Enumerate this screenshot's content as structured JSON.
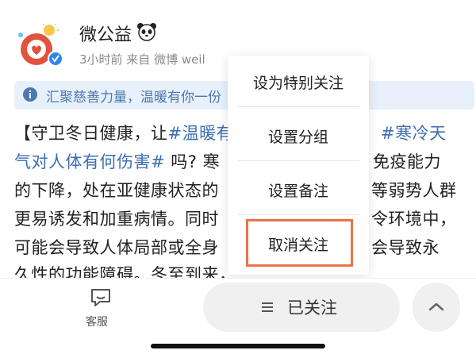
{
  "post": {
    "username": "微公益",
    "meta": "3小时前  来自 微博 weil",
    "banner": "汇聚慈善力量，温暖有你一份",
    "lines": [
      {
        "prefix": "【守卫冬日健康，让",
        "highlight": "#温暖有",
        "right": "#寒冷天"
      },
      {
        "prefix": "",
        "highlight": "气对人体有何伤害#",
        "suffix": " 吗? 寒",
        "right": "免疫能力"
      },
      {
        "prefix": "的下降，处在亚健康状态的",
        "right": "等弱势人群"
      },
      {
        "prefix": "更易诱发和加重病情。同时",
        "right": "令环境中，"
      },
      {
        "prefix": "可能会导致人体局部或全身",
        "right": "会导致永"
      },
      {
        "prefix": "久性的功能障碍。冬至到来，",
        "right": ""
      }
    ]
  },
  "menu": {
    "items": [
      "设为特别关注",
      "设置分组",
      "设置备注",
      "取消关注"
    ]
  },
  "bottom": {
    "service_label": "客服",
    "follow_label": "已关注"
  },
  "colors": {
    "link": "#3c6fb0",
    "highlight_border": "#e8734a",
    "avatar_red": "#e0533c"
  },
  "icons": {
    "avatar": "weibo-charity-logo",
    "badge": "verified-badge-icon",
    "banner": "info-icon",
    "service": "chat-bubble-icon",
    "follow": "menu-lines-icon",
    "up": "chevron-up-icon"
  }
}
